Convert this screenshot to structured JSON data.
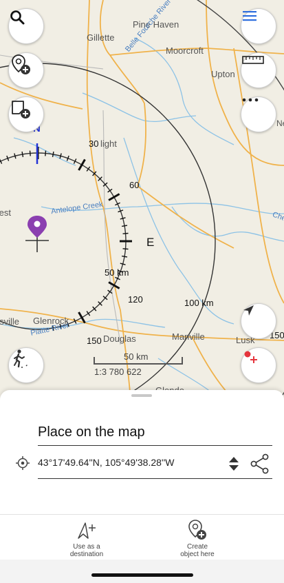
{
  "map": {
    "places": [
      {
        "name": "Gillette"
      },
      {
        "name": "Pine Haven"
      },
      {
        "name": "Moorcroft"
      },
      {
        "name": "Upton"
      },
      {
        "name": "Newcastle"
      },
      {
        "name": "light"
      },
      {
        "name": "West"
      },
      {
        "name": "Glenrock"
      },
      {
        "name": "Douglas"
      },
      {
        "name": "Manville"
      },
      {
        "name": "Lusk"
      },
      {
        "name": "Glendo"
      },
      {
        "name": "Evansville"
      }
    ],
    "rivers": [
      {
        "name": "Belle Fourche River"
      },
      {
        "name": "Antelope Creek"
      },
      {
        "name": "Platte River"
      },
      {
        "name": "Cheyenne"
      }
    ],
    "compass": {
      "north_label": "N",
      "east_label": "E",
      "bearing_labels": [
        "30",
        "60",
        "120",
        "150"
      ],
      "ring_distance_label": "50 km",
      "outer_ring_distance_label": "100 km",
      "outer_ring_partial_label": "150"
    },
    "scale": {
      "distance_label": "50 km",
      "ratio_label": "1:3 780 622"
    },
    "colors": {
      "background": "#f1eee4",
      "road": "#f0b24a",
      "water": "#8cc2e6",
      "pin": "#8b3fb0",
      "accent_blue": "#2f6fde",
      "accent_red": "#e5343c"
    }
  },
  "buttons": {
    "search": "search-icon",
    "layers_add": "location-add-icon",
    "track_add": "map-add-icon",
    "menu": "hamburger-menu-icon",
    "ruler": "ruler-icon",
    "more": "more-horizontal-icon",
    "navigate": "navigation-arrow-icon",
    "add_point": "add-point-icon",
    "hiking": "hiking-route-icon"
  },
  "sheet": {
    "title": "Place on the map",
    "coordinates": "43°17'49.64''N, 105°49'38.28''W"
  },
  "actions": [
    {
      "label_line1": "Use as a",
      "label_line2": "destination"
    },
    {
      "label_line1": "Create",
      "label_line2": "object here"
    }
  ]
}
